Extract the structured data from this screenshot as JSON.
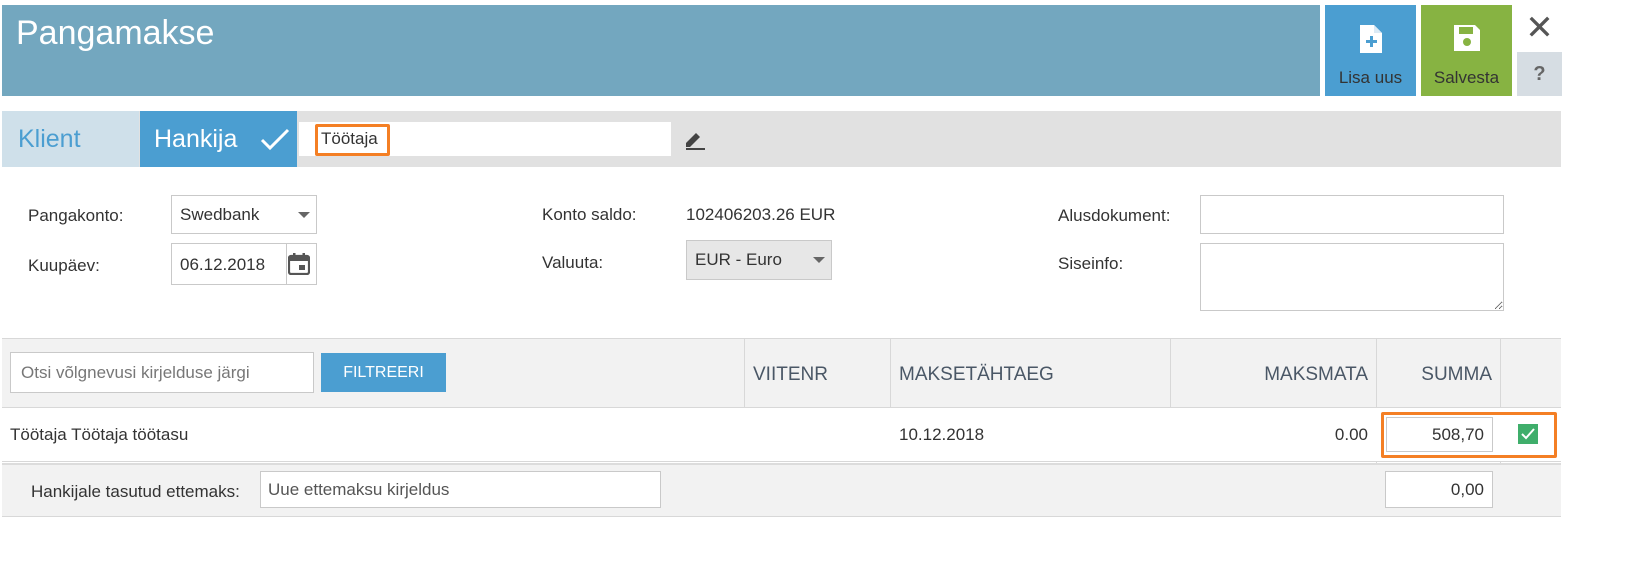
{
  "header": {
    "title": "Pangamakse",
    "add_button_label": "Lisa uus",
    "save_button_label": "Salvesta",
    "close_symbol": "✕",
    "help_symbol": "?"
  },
  "partner_tabs": {
    "tab_client": "Klient",
    "tab_supplier": "Hankija",
    "active_tab": "Hankija",
    "partner_name": "Töötaja"
  },
  "form": {
    "bank_account_label": "Pangakonto:",
    "bank_account_value": "Swedbank",
    "date_label": "Kuupäev:",
    "date_value": "06.12.2018",
    "balance_label": "Konto saldo:",
    "balance_value": "102406203.26 EUR",
    "currency_label": "Valuuta:",
    "currency_value": "EUR - Euro",
    "base_document_label": "Alusdokument:",
    "internal_info_label": "Siseinfo:"
  },
  "table": {
    "search_placeholder": "Otsi võlgnevusi kirjelduse järgi",
    "filter_button_label": "FILTREERI",
    "columns": [
      "VIITENR",
      "MAKSETÄHTAEG",
      "MAKSMATA",
      "SUMMA"
    ],
    "rows": [
      {
        "description": "Töötaja Töötaja töötasu",
        "reference": "",
        "due_date": "10.12.2018",
        "unpaid": "0.00",
        "amount": "508,70",
        "selected": true
      }
    ],
    "prepayment": {
      "label": "Hankijale tasutud ettemaks:",
      "description_placeholder": "Uue ettemaksu kirjeldus",
      "amount": "0,00"
    }
  },
  "colors": {
    "header_bg": "#73a7bf",
    "primary_blue": "#4b9ed1",
    "save_green": "#87b342",
    "highlight_orange": "#f47f24",
    "checkbox_green": "#3fae6b"
  }
}
